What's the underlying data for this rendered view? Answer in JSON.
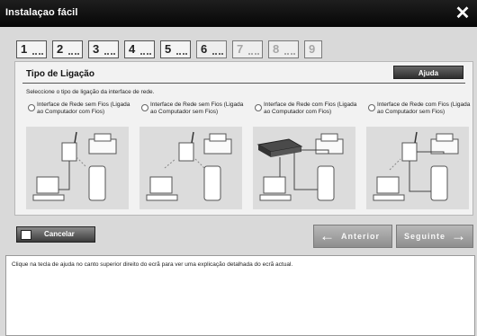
{
  "window": {
    "title": "Instalaçao fácil",
    "close_glyph": "✕"
  },
  "steps": [
    {
      "num": "1",
      "state": "done"
    },
    {
      "num": "2",
      "state": "done"
    },
    {
      "num": "3",
      "state": "done"
    },
    {
      "num": "4",
      "state": "done"
    },
    {
      "num": "5",
      "state": "done"
    },
    {
      "num": "6",
      "state": "current"
    },
    {
      "num": "7",
      "state": "pending"
    },
    {
      "num": "8",
      "state": "pending"
    },
    {
      "num": "9",
      "state": "pending"
    }
  ],
  "panel": {
    "title": "Tipo de Ligação",
    "help_label": "Ajuda",
    "instruction": "Seleccione o tipo de ligação da interface de rede."
  },
  "options": [
    {
      "label": "Interface de Rede sem Fios (Ligada ao Computador com Fios)",
      "selected": false,
      "illustration": "wireless-router-wired-pc"
    },
    {
      "label": "Interface de Rede sem Fios (Ligada ao Computador sem Fios)",
      "selected": false,
      "illustration": "wireless-router-wireless-pc"
    },
    {
      "label": "Interface de Rede com Fios (Ligada ao Computador com Fios)",
      "selected": false,
      "illustration": "wired-hub-wired-pc"
    },
    {
      "label": "Interface de Rede com Fios (Ligada ao Computador sem Fios)",
      "selected": false,
      "illustration": "wireless-ap-wireless-pc"
    }
  ],
  "buttons": {
    "cancel": "Cancelar",
    "prev": "Anterior",
    "next": "Seguinte",
    "prev_glyph": "←",
    "next_glyph": "→"
  },
  "help_text": "Clique na tecla de ajuda no canto superior direito do ecrã para ver uma explicação detalhada do ecrã actual."
}
